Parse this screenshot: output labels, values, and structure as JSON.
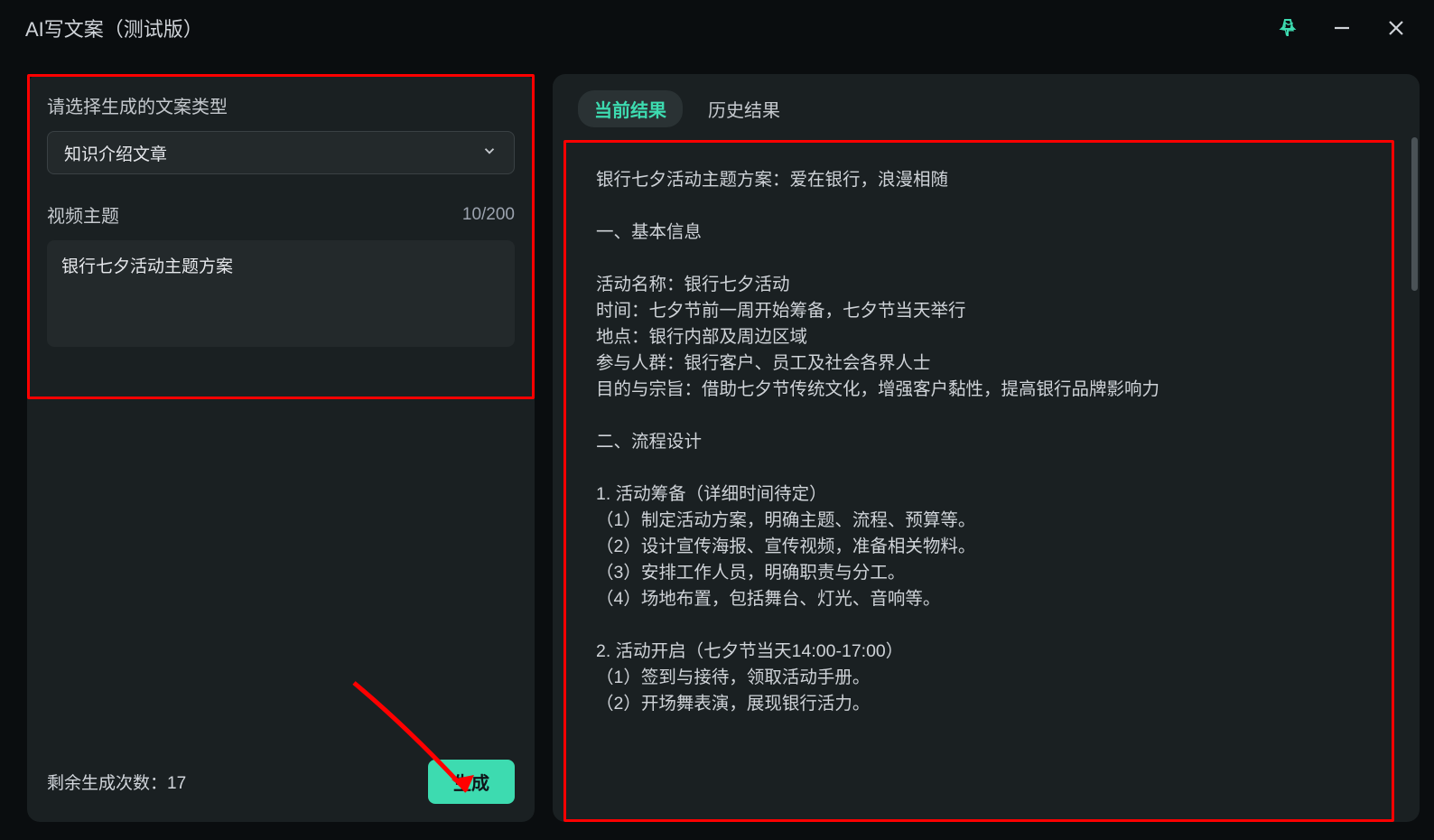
{
  "titlebar": {
    "title": "AI写文案（测试版）"
  },
  "form": {
    "type_label": "请选择生成的文案类型",
    "type_selected": "知识介绍文章",
    "topic_label": "视频主题",
    "topic_counter": "10/200",
    "topic_value": "银行七夕活动主题方案"
  },
  "footer": {
    "remaining_label": "剩余生成次数：",
    "remaining_count": "17",
    "generate_label": "生成"
  },
  "tabs": {
    "current": "当前结果",
    "history": "历史结果"
  },
  "result": {
    "text": "银行七夕活动主题方案：爱在银行，浪漫相随\n\n一、基本信息\n\n活动名称：银行七夕活动\n时间：七夕节前一周开始筹备，七夕节当天举行\n地点：银行内部及周边区域\n参与人群：银行客户、员工及社会各界人士\n目的与宗旨：借助七夕节传统文化，增强客户黏性，提高银行品牌影响力\n\n二、流程设计\n\n1. 活动筹备（详细时间待定）\n（1）制定活动方案，明确主题、流程、预算等。\n（2）设计宣传海报、宣传视频，准备相关物料。\n（3）安排工作人员，明确职责与分工。\n（4）场地布置，包括舞台、灯光、音响等。\n\n2. 活动开启（七夕节当天14:00-17:00）\n（1）签到与接待，领取活动手册。\n（2）开场舞表演，展现银行活力。"
  },
  "colors": {
    "accent": "#3ddbb0",
    "highlight": "#ff0000"
  }
}
